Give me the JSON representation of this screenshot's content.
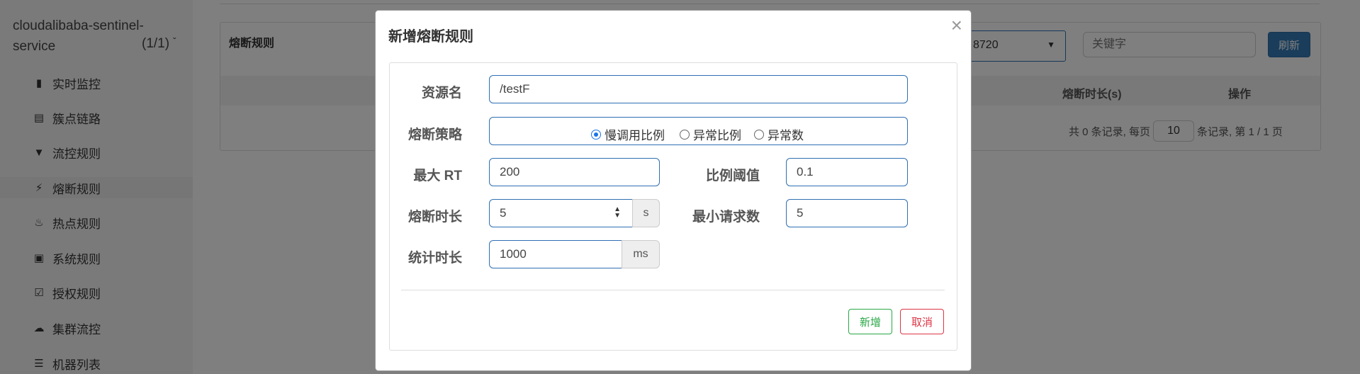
{
  "sidebar": {
    "app_name": "cloudalibaba-sentinel-service",
    "app_count": "(1/1)",
    "items": [
      {
        "label": "实时监控",
        "icon": "bar-chart-icon"
      },
      {
        "label": "簇点链路",
        "icon": "list-icon"
      },
      {
        "label": "流控规则",
        "icon": "filter-icon"
      },
      {
        "label": "熔断规则",
        "icon": "bolt-icon"
      },
      {
        "label": "热点规则",
        "icon": "fire-icon"
      },
      {
        "label": "系统规则",
        "icon": "lock-icon"
      },
      {
        "label": "授权规则",
        "icon": "check-square-icon"
      },
      {
        "label": "集群流控",
        "icon": "cloud-icon"
      },
      {
        "label": "机器列表",
        "icon": "list-bullet-icon"
      }
    ]
  },
  "panel": {
    "title": "熔断规则",
    "machine_value": "8720",
    "keyword_placeholder": "关键字",
    "refresh_label": "刷新",
    "columns": {
      "duration": "熔断时长(s)",
      "actions": "操作"
    },
    "pager": {
      "prefix": "共 0 条记录, 每页",
      "page_size": "10",
      "suffix": "条记录, 第 1 / 1 页"
    }
  },
  "modal": {
    "title": "新增熔断规则",
    "close": "×",
    "resource": {
      "label": "资源名",
      "value": "/testF"
    },
    "strategy": {
      "label": "熔断策略",
      "options": [
        "慢调用比例",
        "异常比例",
        "异常数"
      ],
      "selected": "慢调用比例"
    },
    "max_rt": {
      "label": "最大 RT",
      "value": "200"
    },
    "ratio_threshold": {
      "label": "比例阈值",
      "value": "0.1"
    },
    "break_duration": {
      "label": "熔断时长",
      "value": "5",
      "unit": "s"
    },
    "min_requests": {
      "label": "最小请求数",
      "value": "5"
    },
    "stat_duration": {
      "label": "统计时长",
      "value": "1000",
      "unit": "ms"
    },
    "add_label": "新增",
    "cancel_label": "取消"
  },
  "colors": {
    "primary": "#337ab7",
    "success": "#28a745",
    "danger": "#dc3545",
    "radio": "#1a73e8"
  }
}
